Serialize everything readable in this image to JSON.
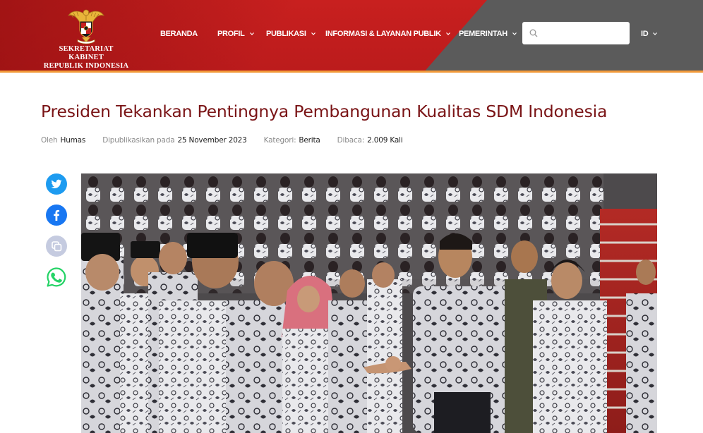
{
  "brand": {
    "logo_line1": "SEKRETARIAT KABINET",
    "logo_line2": "REPUBLIK INDONESIA",
    "logo_icon": "garuda-emblem",
    "primary_red": "#c8201f",
    "accent_orange": "#f29a3a",
    "header_gray": "#5b5b5b",
    "title_color": "#7a1416"
  },
  "nav": {
    "items": [
      {
        "label": "BERANDA"
      },
      {
        "label": "PROFIL"
      },
      {
        "label": "PUBLIKASI"
      },
      {
        "label": "INFORMASI & LAYANAN PUBLIK"
      },
      {
        "label": "PEMERINTAH"
      }
    ],
    "language": "ID",
    "search_placeholder": "",
    "search_value": ""
  },
  "article": {
    "title": "Presiden Tekankan Pentingnya Pembangunan Kualitas SDM Indonesia",
    "meta": {
      "author_label": "Oleh",
      "author": "Humas",
      "published_label": "Dipublikasikan pada",
      "published_date": "25 November 2023",
      "category_label": "Kategori:",
      "category": "Berita",
      "views_label": "Dibaca:",
      "views": "2.009 Kali"
    }
  },
  "share": {
    "icons": [
      "twitter-icon",
      "facebook-icon",
      "copy-link-icon",
      "whatsapp-icon"
    ],
    "twitter_color": "#1d9bf0",
    "facebook_color": "#1877f2",
    "copy_color": "#c5cbe0",
    "whatsapp_color": "#25d366"
  }
}
